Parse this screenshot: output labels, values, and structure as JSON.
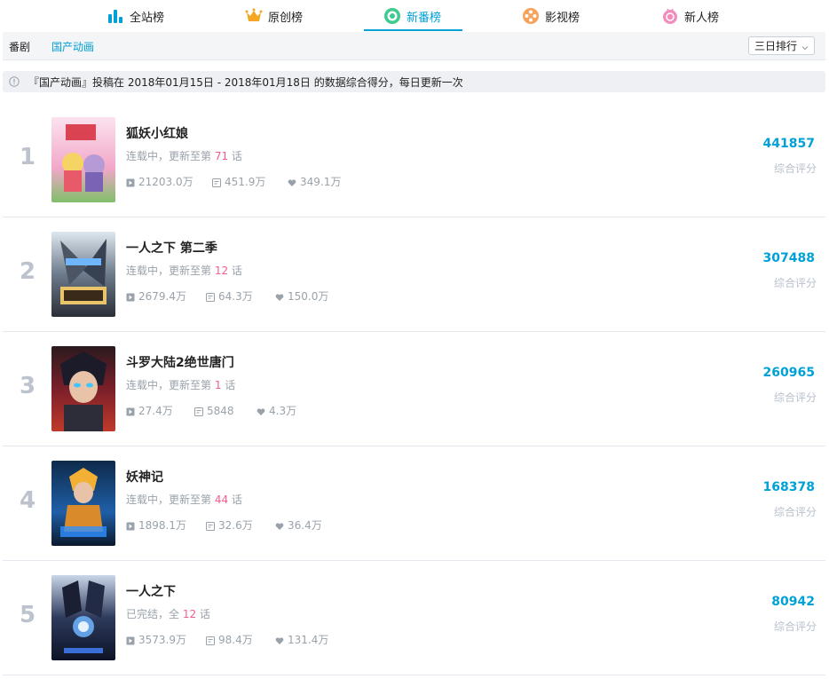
{
  "top_tabs": [
    {
      "label": "全站榜",
      "icon": "bar-chart-icon"
    },
    {
      "label": "原创榜",
      "icon": "crown-icon"
    },
    {
      "label": "新番榜",
      "icon": "target-icon",
      "active": true
    },
    {
      "label": "影视榜",
      "icon": "film-reel-icon"
    },
    {
      "label": "新人榜",
      "icon": "snail-icon"
    }
  ],
  "subnav": {
    "items": [
      "番剧",
      "国产动画"
    ],
    "active": "国产动画",
    "range_select": "三日排行"
  },
  "notice": "『国产动画』投稿在 2018年01月15日 - 2018年01月18日 的数据综合得分，每日更新一次",
  "score_label": "综合评分",
  "colors": {
    "accent": "#00a1d6",
    "episode": "#f25d8e",
    "rank_number": "#bcc3cd",
    "muted": "#99a2aa"
  },
  "items": [
    {
      "rank": "1",
      "title": "狐妖小红娘",
      "status_prefix": "连载中，更新至第 ",
      "episode": "71",
      "status_suffix": " 话",
      "plays": "21203.0万",
      "danmaku": "451.9万",
      "likes": "349.1万",
      "score": "441857"
    },
    {
      "rank": "2",
      "title": "一人之下 第二季",
      "status_prefix": "连载中，更新至第 ",
      "episode": "12",
      "status_suffix": " 话",
      "plays": "2679.4万",
      "danmaku": "64.3万",
      "likes": "150.0万",
      "score": "307488"
    },
    {
      "rank": "3",
      "title": "斗罗大陆2绝世唐门",
      "status_prefix": "连载中，更新至第 ",
      "episode": "1",
      "status_suffix": " 话",
      "plays": "27.4万",
      "danmaku": "5848",
      "likes": "4.3万",
      "score": "260965"
    },
    {
      "rank": "4",
      "title": "妖神记",
      "status_prefix": "连载中，更新至第 ",
      "episode": "44",
      "status_suffix": " 话",
      "plays": "1898.1万",
      "danmaku": "32.6万",
      "likes": "36.4万",
      "score": "168378"
    },
    {
      "rank": "5",
      "title": "一人之下",
      "status_prefix": "已完结，全 ",
      "episode": "12",
      "status_suffix": " 话",
      "plays": "3573.9万",
      "danmaku": "98.4万",
      "likes": "131.4万",
      "score": "80942"
    }
  ]
}
